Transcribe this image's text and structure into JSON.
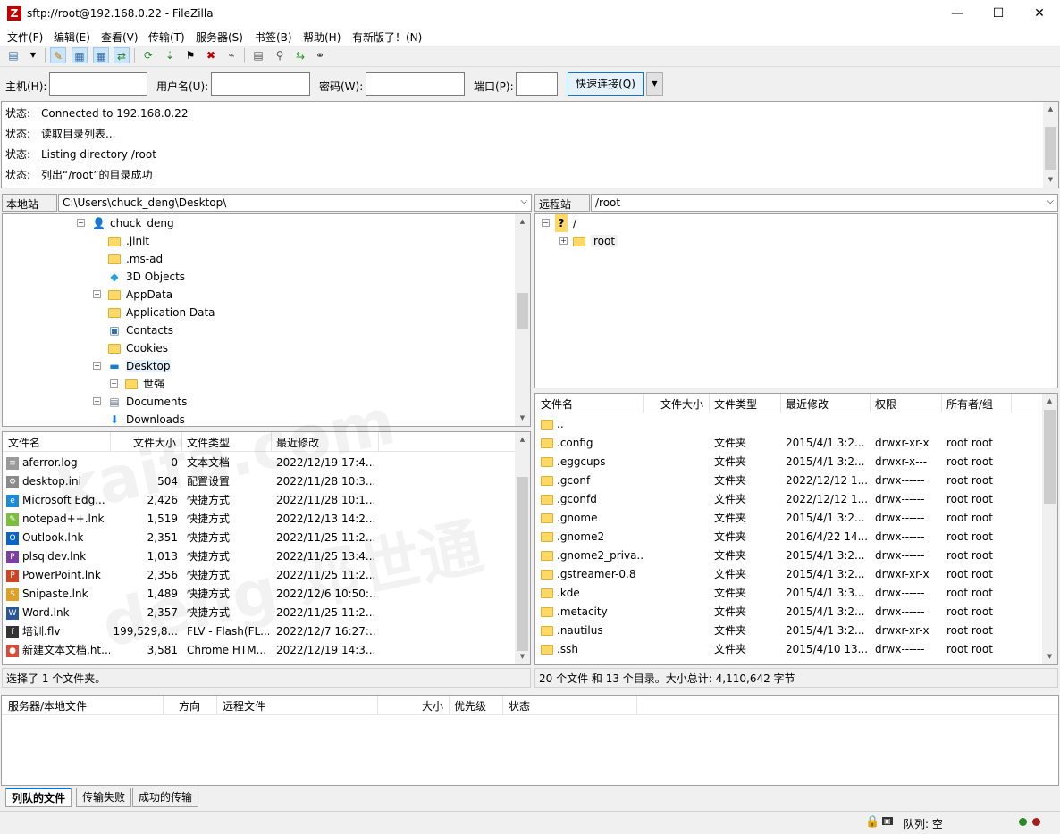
{
  "window": {
    "title": "sftp://root@192.168.0.22 - FileZilla",
    "minimize": "—",
    "maximize": "☐",
    "close": "✕"
  },
  "menu": [
    "文件(F)",
    "编辑(E)",
    "查看(V)",
    "传输(T)",
    "服务器(S)",
    "书签(B)",
    "帮助(H)",
    "有新版了！(N)"
  ],
  "quickconnect": {
    "host_label": "主机(H):",
    "user_label": "用户名(U):",
    "pass_label": "密码(W):",
    "port_label": "端口(P):",
    "connect_button": "快速连接(Q)",
    "host_value": "",
    "user_value": "",
    "pass_value": "",
    "port_value": ""
  },
  "log": [
    {
      "k": "状态:",
      "v": "Connected to 192.168.0.22"
    },
    {
      "k": "状态:",
      "v": "读取目录列表..."
    },
    {
      "k": "状态:",
      "v": "Listing directory /root"
    },
    {
      "k": "状态:",
      "v": "列出“/root”的目录成功"
    }
  ],
  "local": {
    "site_label": "本地站点:",
    "path": "C:\\Users\\chuck_deng\\Desktop\\",
    "tree": [
      {
        "name": "chuck_deng",
        "icon": "user-icon",
        "expander": "-"
      },
      {
        "name": ".jinit",
        "icon": "folder-icon",
        "expander": ""
      },
      {
        "name": ".ms-ad",
        "icon": "folder-icon",
        "expander": ""
      },
      {
        "name": "3D Objects",
        "icon": "cube-icon",
        "expander": ""
      },
      {
        "name": "AppData",
        "icon": "folder-icon",
        "expander": "+"
      },
      {
        "name": "Application Data",
        "icon": "folder-icon",
        "expander": ""
      },
      {
        "name": "Contacts",
        "icon": "contacts-icon",
        "expander": ""
      },
      {
        "name": "Cookies",
        "icon": "folder-icon",
        "expander": ""
      },
      {
        "name": "Desktop",
        "icon": "desktop-icon",
        "expander": "-"
      },
      {
        "name": "世强",
        "icon": "folder-icon",
        "expander": "+"
      },
      {
        "name": "Documents",
        "icon": "documents-icon",
        "expander": "+"
      },
      {
        "name": "Downloads",
        "icon": "download-icon",
        "expander": ""
      }
    ],
    "headers": [
      "文件名",
      "文件大小",
      "文件类型",
      "最近修改"
    ],
    "files": [
      {
        "name": "aferror.log",
        "size": "0",
        "type": "文本文档",
        "mod": "2022/12/19 17:4...",
        "icon": "text-file-icon"
      },
      {
        "name": "desktop.ini",
        "size": "504",
        "type": "配置设置",
        "mod": "2022/11/28 10:3...",
        "icon": "settings-file-icon"
      },
      {
        "name": "Microsoft Edg...",
        "size": "2,426",
        "type": "快捷方式",
        "mod": "2022/11/28 10:1...",
        "icon": "edge-icon"
      },
      {
        "name": "notepad++.lnk",
        "size": "1,519",
        "type": "快捷方式",
        "mod": "2022/12/13 14:2...",
        "icon": "notepad-icon"
      },
      {
        "name": "Outlook.lnk",
        "size": "2,351",
        "type": "快捷方式",
        "mod": "2022/11/25 11:2...",
        "icon": "outlook-icon"
      },
      {
        "name": "plsqldev.lnk",
        "size": "1,013",
        "type": "快捷方式",
        "mod": "2022/11/25 13:4...",
        "icon": "plsql-icon"
      },
      {
        "name": "PowerPoint.lnk",
        "size": "2,356",
        "type": "快捷方式",
        "mod": "2022/11/25 11:2...",
        "icon": "powerpoint-icon"
      },
      {
        "name": "Snipaste.lnk",
        "size": "1,489",
        "type": "快捷方式",
        "mod": "2022/12/6 10:50:...",
        "icon": "snipaste-icon"
      },
      {
        "name": "Word.lnk",
        "size": "2,357",
        "type": "快捷方式",
        "mod": "2022/11/25 11:2...",
        "icon": "word-icon"
      },
      {
        "name": "培训.flv",
        "size": "199,529,8...",
        "type": "FLV - Flash(FL...",
        "mod": "2022/12/7 16:27:...",
        "icon": "flv-icon"
      },
      {
        "name": "新建文本文档.ht...",
        "size": "3,581",
        "type": "Chrome HTM...",
        "mod": "2022/12/19 14:3...",
        "icon": "chrome-icon"
      }
    ],
    "status": "选择了 1 个文件夹。"
  },
  "remote": {
    "site_label": "远程站点:",
    "path": "/root",
    "tree": [
      {
        "name": "/",
        "icon": "unknown-icon",
        "expander": "-"
      },
      {
        "name": "root",
        "icon": "folder-icon",
        "expander": "+"
      }
    ],
    "headers": [
      "文件名",
      "文件大小",
      "文件类型",
      "最近修改",
      "权限",
      "所有者/组"
    ],
    "files": [
      {
        "name": "..",
        "size": "",
        "type": "",
        "mod": "",
        "perm": "",
        "owner": ""
      },
      {
        "name": ".config",
        "size": "",
        "type": "文件夹",
        "mod": "2015/4/1 3:2...",
        "perm": "drwxr-xr-x",
        "owner": "root root"
      },
      {
        "name": ".eggcups",
        "size": "",
        "type": "文件夹",
        "mod": "2015/4/1 3:2...",
        "perm": "drwxr-x---",
        "owner": "root root"
      },
      {
        "name": ".gconf",
        "size": "",
        "type": "文件夹",
        "mod": "2022/12/12 1...",
        "perm": "drwx------",
        "owner": "root root"
      },
      {
        "name": ".gconfd",
        "size": "",
        "type": "文件夹",
        "mod": "2022/12/12 1...",
        "perm": "drwx------",
        "owner": "root root"
      },
      {
        "name": ".gnome",
        "size": "",
        "type": "文件夹",
        "mod": "2015/4/1 3:2...",
        "perm": "drwx------",
        "owner": "root root"
      },
      {
        "name": ".gnome2",
        "size": "",
        "type": "文件夹",
        "mod": "2016/4/22 14...",
        "perm": "drwx------",
        "owner": "root root"
      },
      {
        "name": ".gnome2_priva...",
        "size": "",
        "type": "文件夹",
        "mod": "2015/4/1 3:2...",
        "perm": "drwx------",
        "owner": "root root"
      },
      {
        "name": ".gstreamer-0.8",
        "size": "",
        "type": "文件夹",
        "mod": "2015/4/1 3:2...",
        "perm": "drwxr-xr-x",
        "owner": "root root"
      },
      {
        "name": ".kde",
        "size": "",
        "type": "文件夹",
        "mod": "2015/4/1 3:3...",
        "perm": "drwx------",
        "owner": "root root"
      },
      {
        "name": ".metacity",
        "size": "",
        "type": "文件夹",
        "mod": "2015/4/1 3:2...",
        "perm": "drwx------",
        "owner": "root root"
      },
      {
        "name": ".nautilus",
        "size": "",
        "type": "文件夹",
        "mod": "2015/4/1 3:2...",
        "perm": "drwxr-xr-x",
        "owner": "root root"
      },
      {
        "name": ".ssh",
        "size": "",
        "type": "文件夹",
        "mod": "2015/4/10 13...",
        "perm": "drwx------",
        "owner": "root root"
      }
    ],
    "status": "20 个文件 和 13 个目录。大小总计: 4,110,642 字节"
  },
  "queue": {
    "headers": [
      "服务器/本地文件",
      "方向",
      "远程文件",
      "大小",
      "优先级",
      "状态"
    ],
    "tabs": [
      "列队的文件",
      "传输失败",
      "成功的传输"
    ],
    "status": "队列: 空"
  },
  "watermarks": [
    "kaifa.com",
    "deng 邓世通"
  ]
}
